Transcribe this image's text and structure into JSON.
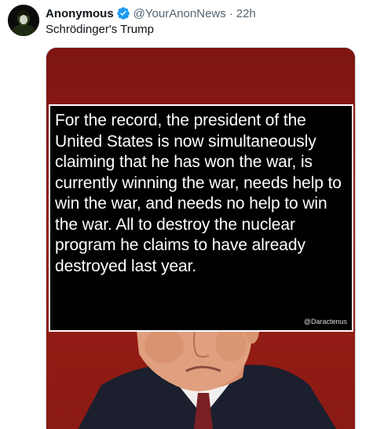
{
  "tweet": {
    "author_name": "Anonymous",
    "handle": "@YourAnonNews",
    "separator": "·",
    "time": "22h",
    "text": "Schrödinger's Trump"
  },
  "media": {
    "quote": "For the record, the president of the United States is now simultaneously claiming that he has won the war, is currently winning the war, needs help to win the war, and needs no help to win the war. All to destroy the nuclear program he claims to have already destroyed last year.",
    "credit": "@Daractenus"
  },
  "icons": {
    "avatar": "masked-avatar-icon",
    "verified": "verified-badge-icon"
  },
  "colors": {
    "verified": "#1d9bf0",
    "media_background": "#8c1a14",
    "secondary_text": "#536471"
  }
}
